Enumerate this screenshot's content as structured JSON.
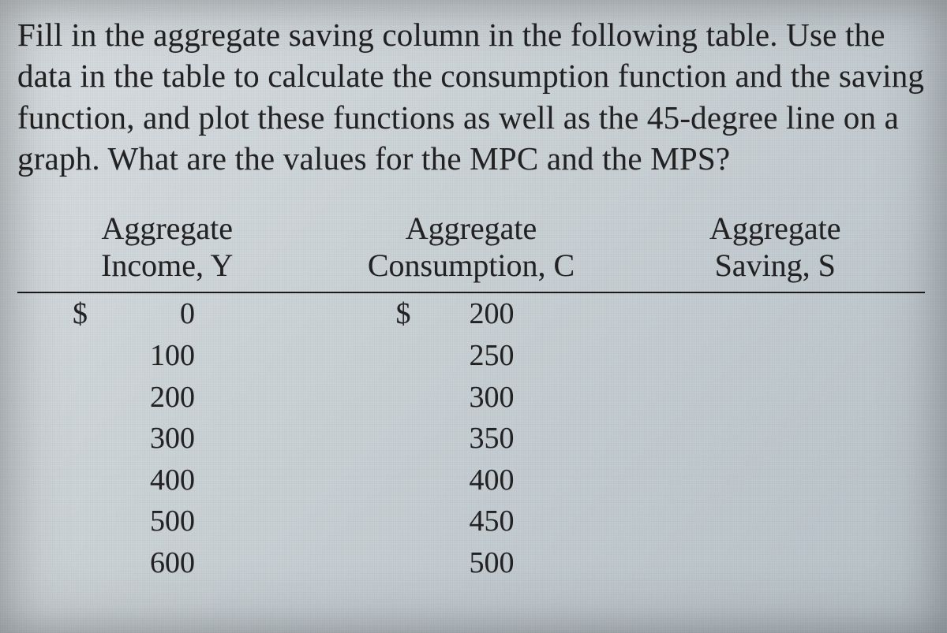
{
  "question_text": "Fill in the aggregate saving column in the following table. Use the data in the table to calculate the consumption function and the saving function, and plot these functions as well as the 45-degree line on a graph. What are the values for the MPC and the MPS?",
  "table": {
    "headers": {
      "income": "Aggregate Income, Y",
      "consumption": "Aggregate Consumption, C",
      "saving": "Aggregate Saving, S"
    },
    "currency_symbol": "$",
    "rows": [
      {
        "income": "0",
        "income_has_currency": true,
        "consumption": "200",
        "consumption_has_currency": true,
        "saving": ""
      },
      {
        "income": "100",
        "income_has_currency": false,
        "consumption": "250",
        "consumption_has_currency": false,
        "saving": ""
      },
      {
        "income": "200",
        "income_has_currency": false,
        "consumption": "300",
        "consumption_has_currency": false,
        "saving": ""
      },
      {
        "income": "300",
        "income_has_currency": false,
        "consumption": "350",
        "consumption_has_currency": false,
        "saving": ""
      },
      {
        "income": "400",
        "income_has_currency": false,
        "consumption": "400",
        "consumption_has_currency": false,
        "saving": ""
      },
      {
        "income": "500",
        "income_has_currency": false,
        "consumption": "450",
        "consumption_has_currency": false,
        "saving": ""
      },
      {
        "income": "600",
        "income_has_currency": false,
        "consumption": "500",
        "consumption_has_currency": false,
        "saving": ""
      }
    ]
  }
}
